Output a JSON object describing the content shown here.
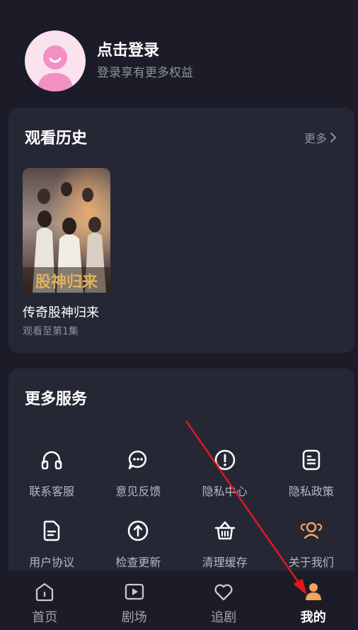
{
  "profile": {
    "title": "点击登录",
    "subtitle": "登录享有更多权益"
  },
  "history": {
    "title": "观看历史",
    "more_label": "更多",
    "items": [
      {
        "poster_text": "股神归来",
        "title": "传奇股神归来",
        "progress": "观看至第1集"
      }
    ]
  },
  "services": {
    "title": "更多服务",
    "items": [
      {
        "label": "联系客服",
        "icon": "headset-icon"
      },
      {
        "label": "意见反馈",
        "icon": "chat-bubble-icon"
      },
      {
        "label": "隐私中心",
        "icon": "exclamation-circle-icon"
      },
      {
        "label": "隐私政策",
        "icon": "document-list-icon"
      },
      {
        "label": "用户协议",
        "icon": "document-icon"
      },
      {
        "label": "检查更新",
        "icon": "arrow-up-circle-icon"
      },
      {
        "label": "清理缓存",
        "icon": "basket-icon"
      },
      {
        "label": "关于我们",
        "icon": "group-icon"
      }
    ]
  },
  "nav": {
    "items": [
      {
        "label": "首页",
        "icon": "home-icon",
        "active": false
      },
      {
        "label": "剧场",
        "icon": "play-icon",
        "active": false
      },
      {
        "label": "追剧",
        "icon": "heart-icon",
        "active": false
      },
      {
        "label": "我的",
        "icon": "person-icon",
        "active": true
      }
    ]
  },
  "colors": {
    "background": "#1b1c27",
    "card": "#262735",
    "muted_text": "#8e909c",
    "accent": "#f5a25d",
    "annotation_arrow": "#e0191e",
    "avatar_bg": "#fbe3ee",
    "avatar_figure": "#f290c4"
  }
}
